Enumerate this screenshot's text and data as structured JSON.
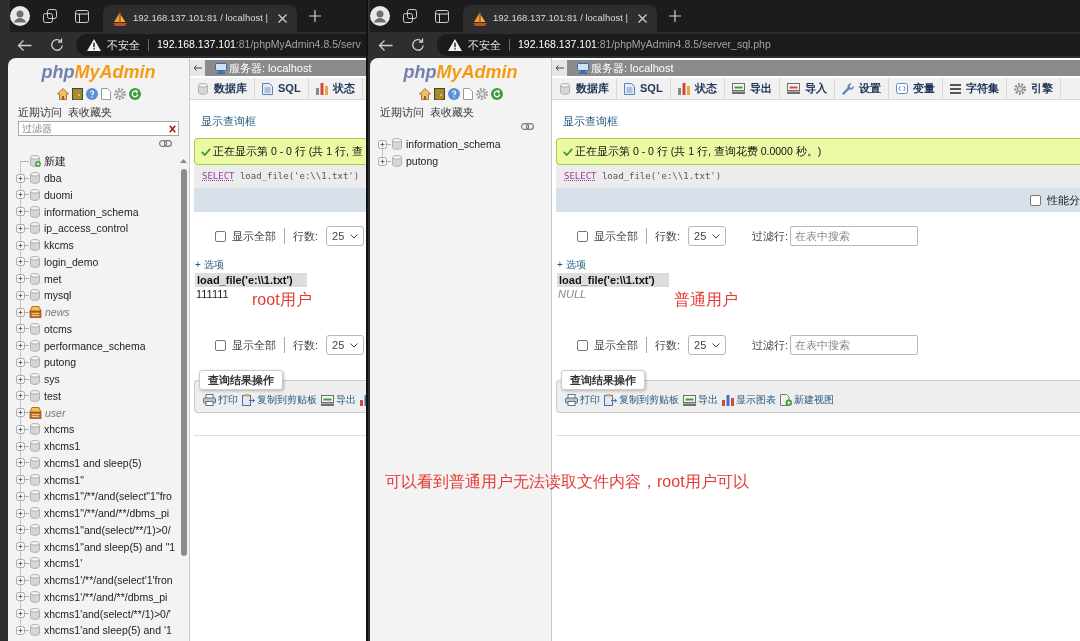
{
  "windows": [
    {
      "tab": {
        "title": "192.168.137.101:81 / localhost |"
      },
      "address": {
        "security": "不安全",
        "host": "192.168.137.101",
        "path": ":81/phpMyAdmin4.8.5/serv"
      },
      "sidebar": {
        "logo": [
          "php",
          "MyAdmin"
        ],
        "links": [
          "近期访问",
          "表收藏夹"
        ],
        "filter": {
          "placeholder": "过滤器"
        },
        "tree": [
          {
            "label": "新建",
            "kind": "new"
          },
          {
            "label": "dba",
            "kind": "db",
            "expanded": false
          },
          {
            "label": "duomi",
            "kind": "db",
            "expanded": false
          },
          {
            "label": "information_schema",
            "kind": "db",
            "expanded": false
          },
          {
            "label": "ip_access_control",
            "kind": "db",
            "expanded": false
          },
          {
            "label": "kkcms",
            "kind": "db",
            "expanded": false
          },
          {
            "label": "login_demo",
            "kind": "db",
            "expanded": false
          },
          {
            "label": "met",
            "kind": "db",
            "expanded": false
          },
          {
            "label": "mysql",
            "kind": "db",
            "expanded": false
          },
          {
            "label": "news",
            "kind": "alt",
            "expanded": false
          },
          {
            "label": "otcms",
            "kind": "db",
            "expanded": false
          },
          {
            "label": "performance_schema",
            "kind": "db",
            "expanded": false
          },
          {
            "label": "putong",
            "kind": "db",
            "expanded": false
          },
          {
            "label": "sys",
            "kind": "db",
            "expanded": false
          },
          {
            "label": "test",
            "kind": "db",
            "expanded": false
          },
          {
            "label": "user",
            "kind": "alt",
            "expanded": false
          },
          {
            "label": "xhcms",
            "kind": "db",
            "expanded": false
          },
          {
            "label": "xhcms1",
            "kind": "db",
            "expanded": false
          },
          {
            "label": "xhcms1 and sleep(5)",
            "kind": "db",
            "expanded": false
          },
          {
            "label": "xhcms1\"",
            "kind": "db",
            "expanded": false
          },
          {
            "label": "xhcms1\"/**/and(select\"1\"fro",
            "kind": "db",
            "expanded": false
          },
          {
            "label": "xhcms1\"/**/and/**/dbms_pi",
            "kind": "db",
            "expanded": false
          },
          {
            "label": "xhcms1\"and(select/**/1)>0/",
            "kind": "db",
            "expanded": false
          },
          {
            "label": "xhcms1\"and sleep(5) and \"1",
            "kind": "db",
            "expanded": false
          },
          {
            "label": "xhcms1'",
            "kind": "db",
            "expanded": false
          },
          {
            "label": "xhcms1'/**/and(select'1'fron",
            "kind": "db",
            "expanded": false
          },
          {
            "label": "xhcms1'/**/and/**/dbms_pi",
            "kind": "db",
            "expanded": false
          },
          {
            "label": "xhcms1'and(select/**/1)>0/'",
            "kind": "db",
            "expanded": false
          },
          {
            "label": "xhcms1'and sleep(5) and '1",
            "kind": "db",
            "expanded": false
          }
        ]
      },
      "main": {
        "breadcrumb": "服务器: localhost",
        "tabs": [
          {
            "label": "数据库",
            "kind": "databases"
          },
          {
            "label": "SQL",
            "kind": "sql"
          },
          {
            "label": "状态",
            "kind": "status"
          }
        ],
        "query_link": "显示查询框",
        "message": "正在显示第 0 - 0 行 (共 1 行, 查",
        "sql": {
          "keyword": "SELECT",
          "rest": " load_file('e:\\\\1.txt')"
        },
        "controls": [
          {
            "show_all": {
              "label": "显示全部",
              "checked": false
            },
            "rows_label": "行数:",
            "rows_value": "25"
          },
          {
            "show_all": {
              "label": "显示全部",
              "checked": false
            },
            "rows_label": "行数:",
            "rows_value": "25"
          }
        ],
        "options_link": "+ 选项",
        "column": "load_file('e:\\\\1.txt')",
        "cell": {
          "value": "111111",
          "is_null": false
        },
        "note": "root用户",
        "ops": {
          "title": "查询结果操作",
          "actions": [
            {
              "label": "打印",
              "kind": "print"
            },
            {
              "label": "复制到剪贴板",
              "kind": "copy"
            },
            {
              "label": "导出",
              "kind": "export"
            },
            {
              "kind": "chart"
            }
          ]
        }
      }
    },
    {
      "tab": {
        "title": "192.168.137.101:81 / localhost |"
      },
      "address": {
        "security": "不安全",
        "host": "192.168.137.101",
        "path": ":81/phpMyAdmin4.8.5/server_sql.php"
      },
      "sidebar": {
        "logo": [
          "php",
          "MyAdmin"
        ],
        "links": [
          "近期访问",
          "表收藏夹"
        ],
        "tree": [
          {
            "label": "information_schema",
            "kind": "db",
            "expanded": false
          },
          {
            "label": "putong",
            "kind": "db",
            "expanded": false
          }
        ]
      },
      "main": {
        "breadcrumb": "服务器: localhost",
        "tabs": [
          {
            "label": "数据库",
            "kind": "databases"
          },
          {
            "label": "SQL",
            "kind": "sql"
          },
          {
            "label": "状态",
            "kind": "status"
          },
          {
            "label": "导出",
            "kind": "export"
          },
          {
            "label": "导入",
            "kind": "import"
          },
          {
            "label": "设置",
            "kind": "settings"
          },
          {
            "label": "变量",
            "kind": "variables"
          },
          {
            "label": "字符集",
            "kind": "charsets"
          },
          {
            "label": "引擎",
            "kind": "engines"
          }
        ],
        "query_link": "显示查询框",
        "message": "正在显示第 0 - 0 行 (共 1 行, 查询花费 0.0000 秒。)",
        "sql": {
          "keyword": "SELECT",
          "rest": " load_file('e:\\\\1.txt')"
        },
        "profiling": {
          "label": "性能分",
          "checked": false
        },
        "controls": [
          {
            "show_all": {
              "label": "显示全部",
              "checked": false
            },
            "rows_label": "行数:",
            "rows_value": "25",
            "filter_label": "过滤行:",
            "filter_placeholder": "在表中搜索"
          },
          {
            "show_all": {
              "label": "显示全部",
              "checked": false
            },
            "rows_label": "行数:",
            "rows_value": "25",
            "filter_label": "过滤行:",
            "filter_placeholder": "在表中搜索"
          }
        ],
        "options_link": "+ 选项",
        "column": "load_file('e:\\\\1.txt')",
        "cell": {
          "value": "NULL",
          "is_null": true
        },
        "note": "普通用户",
        "ops": {
          "title": "查询结果操作",
          "actions": [
            {
              "label": "打印",
              "kind": "print"
            },
            {
              "label": "复制到剪贴板",
              "kind": "copy"
            },
            {
              "label": "导出",
              "kind": "export"
            },
            {
              "label": "显示图表",
              "kind": "chart"
            },
            {
              "label": "新建视图",
              "kind": "view"
            }
          ]
        }
      }
    }
  ],
  "caption": "可以看到普通用户无法读取文件内容，root用户可以"
}
